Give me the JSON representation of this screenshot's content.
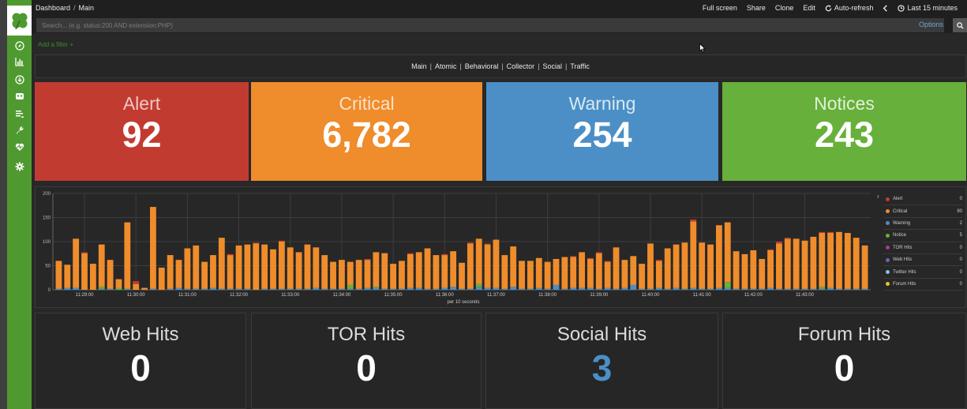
{
  "header": {
    "breadcrumb": [
      "Dashboard",
      "Main"
    ],
    "actions": [
      "Full screen",
      "Share",
      "Clone",
      "Edit",
      "Auto-refresh"
    ],
    "time_range": "Last 15 minutes"
  },
  "search": {
    "placeholder": "Search... (e.g. status:200 AND extension:PHP)",
    "options_label": "Options"
  },
  "filter": {
    "add_label": "Add a filter +"
  },
  "nav": {
    "links": [
      "Main",
      "Atomic",
      "Behavioral",
      "Collector",
      "Social",
      "Traffic"
    ]
  },
  "metrics": [
    {
      "label": "Alert",
      "value": "92",
      "color": "#c23b31"
    },
    {
      "label": "Critical",
      "value": "6,782",
      "color": "#ef8c2b"
    },
    {
      "label": "Warning",
      "value": "254",
      "color": "#4b8fc6"
    },
    {
      "label": "Notices",
      "value": "243",
      "color": "#67b03b"
    }
  ],
  "hits": [
    {
      "label": "Web Hits",
      "value": "0"
    },
    {
      "label": "TOR Hits",
      "value": "0"
    },
    {
      "label": "Social Hits",
      "value": "3"
    },
    {
      "label": "Forum Hits",
      "value": "0"
    }
  ],
  "colors": {
    "sidebar": "#4f9a30",
    "critical_series": "#ef8c2b",
    "warning_series": "#4b8fc6",
    "notice_series": "#67b03b",
    "alert_series": "#c23b31"
  },
  "sidebar_icons": [
    "compass-icon",
    "bar-chart-icon",
    "download-icon",
    "shield-icon",
    "list-icon",
    "wrench-icon",
    "heartbeat-icon",
    "gear-icon"
  ],
  "chart_data": {
    "type": "bar",
    "stacked": true,
    "xlabel": "per 10 seconds",
    "ylim": [
      0,
      200
    ],
    "yticks": [
      0,
      50,
      100,
      150,
      200
    ],
    "grid": true,
    "legend_position": "right",
    "x_tick_labels": [
      "11:29:00",
      "11:30:00",
      "11:31:00",
      "11:32:00",
      "11:33:00",
      "11:34:00",
      "11:35:00",
      "11:36:00",
      "11:37:00",
      "11:38:00",
      "11:39:00",
      "11:40:00",
      "11:41:00",
      "11:42:00",
      "11:43:00"
    ],
    "legend": [
      {
        "name": "Alert",
        "count": "0",
        "color": "#c23b31"
      },
      {
        "name": "Critical",
        "count": "90",
        "color": "#ef8c2b"
      },
      {
        "name": "Warning",
        "count": "2",
        "color": "#4b8fc6"
      },
      {
        "name": "Notice",
        "count": "5",
        "color": "#67b03b"
      },
      {
        "name": "TOR Hits",
        "count": "0",
        "color": "#9b3fa0"
      },
      {
        "name": "Web Hits",
        "count": "0",
        "color": "#7a5fb0"
      },
      {
        "name": "Twitter Hits",
        "count": "0",
        "color": "#7ec2e8"
      },
      {
        "name": "Forum Hits",
        "count": "0",
        "color": "#e8c234"
      }
    ],
    "series": [
      {
        "name": "Critical",
        "values": [
          58,
          48,
          102,
          76,
          54,
          88,
          60,
          18,
          138,
          12,
          4,
          170,
          46,
          70,
          58,
          84,
          90,
          56,
          68,
          106,
          70,
          90,
          92,
          96,
          92,
          82,
          98,
          86,
          76,
          92,
          84,
          70,
          56,
          60,
          48,
          60,
          58,
          72,
          74,
          52,
          58,
          70,
          74,
          84,
          70,
          68,
          74,
          54,
          94,
          94,
          90,
          100,
          70,
          84,
          58,
          58,
          62,
          56,
          54,
          66,
          64,
          74,
          60,
          74,
          54,
          86,
          58,
          60,
          52,
          94,
          56,
          84,
          90,
          96,
          138,
          96,
          92,
          130,
          124,
          78,
          72,
          80,
          62,
          78,
          94,
          104,
          104,
          100,
          108,
          112,
          114,
          118,
          116,
          106,
          90
        ]
      },
      {
        "name": "Warning",
        "values": [
          2,
          4,
          4,
          0,
          0,
          2,
          2,
          0,
          2,
          0,
          0,
          2,
          0,
          2,
          4,
          2,
          2,
          2,
          4,
          2,
          2,
          2,
          2,
          0,
          2,
          2,
          2,
          2,
          2,
          2,
          4,
          2,
          2,
          2,
          2,
          2,
          4,
          4,
          2,
          2,
          2,
          4,
          4,
          2,
          2,
          4,
          6,
          2,
          2,
          6,
          4,
          4,
          2,
          6,
          2,
          2,
          4,
          2,
          10,
          2,
          4,
          4,
          4,
          2,
          4,
          2,
          4,
          10,
          2,
          2,
          4,
          2,
          4,
          2,
          4,
          2,
          2,
          4,
          4,
          2,
          2,
          2,
          2,
          4,
          2,
          2,
          2,
          2,
          2,
          2,
          4,
          2,
          2,
          2,
          2
        ]
      },
      {
        "name": "Notice",
        "values": [
          0,
          0,
          0,
          0,
          0,
          4,
          0,
          4,
          0,
          0,
          0,
          0,
          0,
          0,
          0,
          0,
          0,
          0,
          0,
          0,
          0,
          0,
          0,
          0,
          0,
          0,
          0,
          0,
          0,
          0,
          0,
          0,
          0,
          0,
          8,
          0,
          0,
          2,
          0,
          0,
          0,
          0,
          0,
          0,
          0,
          0,
          0,
          0,
          0,
          6,
          0,
          0,
          0,
          0,
          0,
          0,
          0,
          0,
          0,
          0,
          0,
          0,
          0,
          0,
          0,
          0,
          0,
          0,
          0,
          0,
          0,
          0,
          0,
          0,
          0,
          0,
          0,
          0,
          12,
          0,
          0,
          0,
          0,
          0,
          0,
          0,
          0,
          0,
          0,
          4,
          0,
          0,
          0,
          0,
          0
        ]
      },
      {
        "name": "Alert",
        "values": [
          0,
          0,
          0,
          2,
          0,
          0,
          0,
          0,
          0,
          6,
          0,
          0,
          0,
          0,
          0,
          0,
          0,
          0,
          0,
          0,
          2,
          0,
          0,
          2,
          0,
          0,
          2,
          0,
          0,
          0,
          0,
          0,
          0,
          0,
          0,
          0,
          2,
          0,
          0,
          0,
          0,
          2,
          0,
          0,
          0,
          2,
          0,
          0,
          2,
          0,
          2,
          0,
          0,
          0,
          0,
          0,
          0,
          0,
          0,
          0,
          2,
          0,
          2,
          2,
          2,
          0,
          0,
          0,
          0,
          0,
          2,
          0,
          0,
          0,
          4,
          0,
          0,
          0,
          0,
          0,
          0,
          0,
          0,
          2,
          4,
          2,
          0,
          0,
          0,
          2,
          2,
          0,
          0,
          0,
          0
        ]
      }
    ]
  }
}
